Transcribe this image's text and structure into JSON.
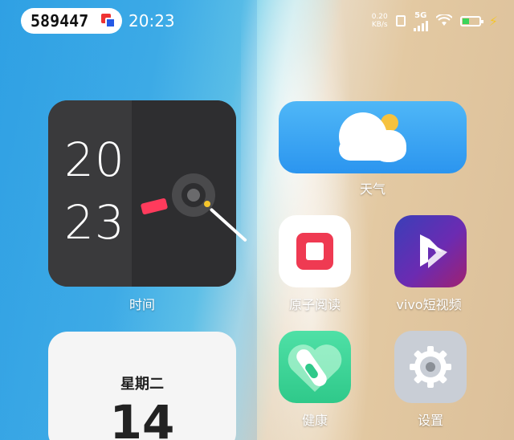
{
  "status_bar": {
    "badge_number": "589447",
    "time": "20:23",
    "net_speed_value": "0.20",
    "net_speed_unit": "KB/s",
    "network_type": "5G"
  },
  "widgets": {
    "clock": {
      "hour": "20",
      "minute": "23",
      "label": "时间"
    },
    "weather": {
      "label": "天气"
    },
    "calendar": {
      "weekday": "星期二",
      "day": "14"
    }
  },
  "apps": [
    {
      "label": "原子阅读",
      "icon": "atom-reader-icon"
    },
    {
      "label": "vivo短视频",
      "icon": "vivo-video-play-icon"
    },
    {
      "label": "健康",
      "icon": "health-heart-icon"
    },
    {
      "label": "设置",
      "icon": "settings-gear-icon"
    }
  ],
  "colors": {
    "reader_red": "#ef3a52",
    "health_green": "#2fc98a",
    "video_purple": "#6b2bb2",
    "weather_blue": "#2b95ef",
    "battery_green": "#3bd45a",
    "charging_yellow": "#f5c52b"
  }
}
